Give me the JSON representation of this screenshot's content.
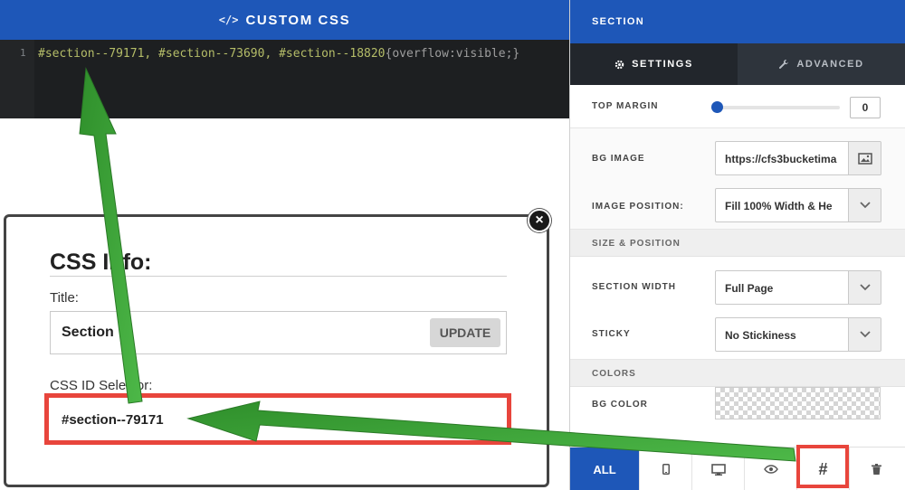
{
  "editor": {
    "title": "CUSTOM CSS",
    "line_number": "1",
    "code_selectors": "#section--79171, #section--73690, #section--18820",
    "code_rule": "{overflow:visible;}"
  },
  "modal": {
    "close": "×",
    "title": "CSS Info:",
    "title_label": "Title:",
    "title_value": "Section",
    "update_label": "UPDATE",
    "selector_label": "CSS ID Selector:",
    "selector_value": "#section--79171"
  },
  "panel": {
    "header": "SECTION",
    "tabs": [
      {
        "label": "SETTINGS",
        "icon": "gear-icon"
      },
      {
        "label": "ADVANCED",
        "icon": "wrench-icon"
      }
    ],
    "top_margin": {
      "label": "TOP MARGIN",
      "value": "0",
      "fraction": 0
    },
    "bg_image": {
      "label": "BG IMAGE",
      "value": "https://cfs3bucketima",
      "icon": "image-icon"
    },
    "image_position": {
      "label": "IMAGE POSITION:",
      "value": "Fill 100% Width & He"
    },
    "size_position_header": "SIZE & POSITION",
    "section_width": {
      "label": "SECTION WIDTH",
      "value": "Full Page"
    },
    "sticky": {
      "label": "STICKY",
      "value": "No Stickiness"
    },
    "colors_header": "COLORS",
    "bg_color": {
      "label": "BG COLOR"
    }
  },
  "bottom_bar": {
    "all_label": "ALL",
    "hash_label": "#",
    "icons": [
      "mobile-icon",
      "desktop-icon",
      "eye-icon",
      "hash-icon",
      "trash-icon"
    ]
  },
  "colors": {
    "brand_blue": "#1e57b8",
    "highlight_red": "#e8453c",
    "arrow_green": "#3aa335"
  }
}
